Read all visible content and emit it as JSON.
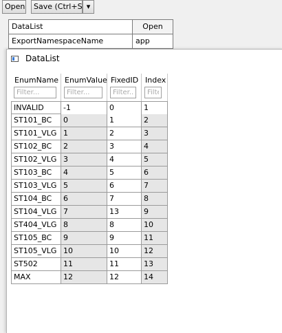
{
  "toolbar": {
    "open_label": "Open",
    "save_label": "Save (Ctrl+S)",
    "dropdown_glyph": "▾"
  },
  "background_grid": {
    "rows": [
      {
        "name": "DataList",
        "value": "Open"
      },
      {
        "name": "ExportNamespaceName",
        "value": "app"
      }
    ]
  },
  "window": {
    "title": "DataList"
  },
  "table": {
    "columns": [
      {
        "label": "EnumName",
        "filter_placeholder": "Filter..."
      },
      {
        "label": "EnumValue",
        "filter_placeholder": "Filter..."
      },
      {
        "label": "FixedID",
        "filter_placeholder": "Filter..."
      },
      {
        "label": "Index",
        "filter_placeholder": "Filter..."
      }
    ],
    "rows": [
      [
        "INVALID",
        "-1",
        "0",
        "1"
      ],
      [
        "ST101_BC",
        "0",
        "1",
        "2"
      ],
      [
        "ST101_VLG",
        "1",
        "2",
        "3"
      ],
      [
        "ST102_BC",
        "2",
        "3",
        "4"
      ],
      [
        "ST102_VLG",
        "3",
        "4",
        "5"
      ],
      [
        "ST103_BC",
        "4",
        "5",
        "6"
      ],
      [
        "ST103_VLG",
        "5",
        "6",
        "7"
      ],
      [
        "ST104_BC",
        "6",
        "7",
        "8"
      ],
      [
        "ST104_VLG",
        "7",
        "13",
        "9"
      ],
      [
        "ST404_VLG",
        "8",
        "8",
        "10"
      ],
      [
        "ST105_BC",
        "9",
        "9",
        "11"
      ],
      [
        "ST105_VLG",
        "10",
        "10",
        "12"
      ],
      [
        "ST502",
        "11",
        "11",
        "13"
      ],
      [
        "MAX",
        "12",
        "12",
        "14"
      ]
    ]
  }
}
